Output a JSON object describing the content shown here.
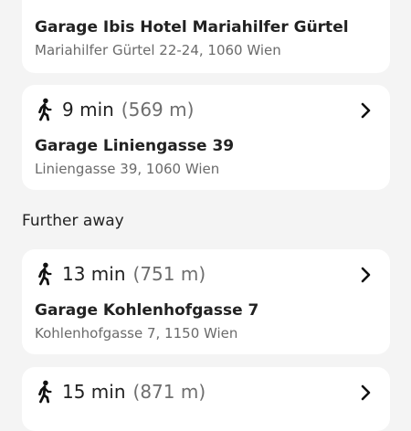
{
  "cards": [
    {
      "name": "Garage Ibis Hotel Mariahilfer Gürtel",
      "address": "Mariahilfer Gürtel 22-24, 1060 Wien"
    },
    {
      "duration": "9 min",
      "distance": "(569 m)",
      "name": "Garage Liniengasse 39",
      "address": "Liniengasse 39, 1060 Wien"
    },
    {
      "duration": "13 min",
      "distance": "(751 m)",
      "name": "Garage Kohlenhofgasse 7",
      "address": "Kohlenhofgasse 7, 1150 Wien"
    },
    {
      "duration": "15 min",
      "distance": "(871 m)"
    }
  ],
  "section_further_away": "Further away",
  "icons": {
    "walk": "walking-person-icon",
    "chevron": "chevron-right-icon"
  }
}
